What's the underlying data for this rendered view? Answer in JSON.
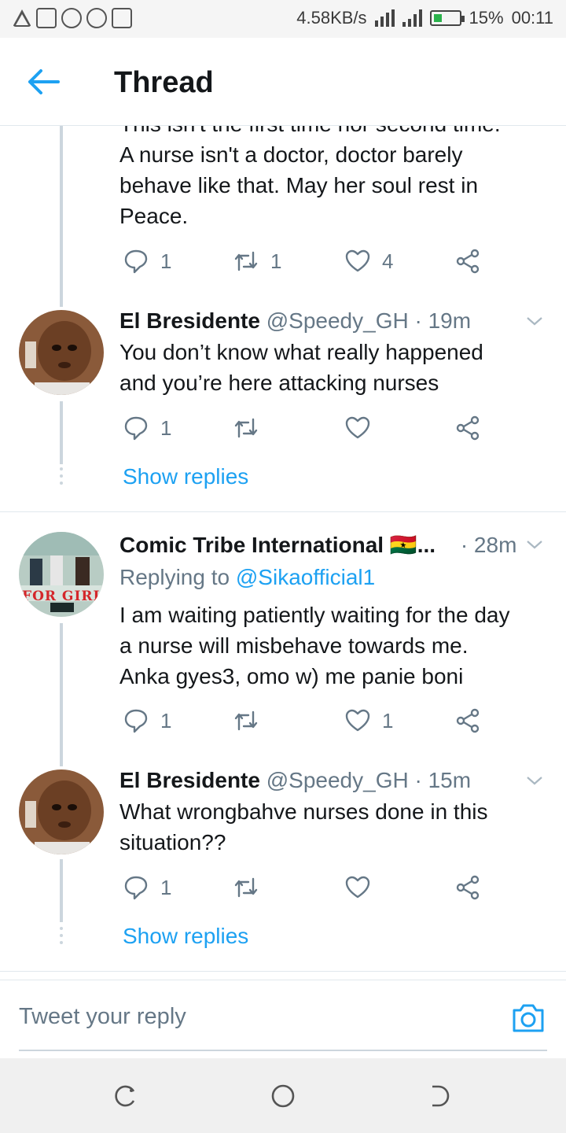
{
  "status_bar": {
    "net_speed": "4.58KB/s",
    "battery": "15%",
    "time": "00:11"
  },
  "header": {
    "title": "Thread"
  },
  "tweets": [
    {
      "text": "This isn't the first time nor second time.\nA nurse isn't a doctor, doctor barely\nbehave like that. May her soul rest in\nPeace.",
      "replies": "1",
      "retweets": "1",
      "likes": "4"
    },
    {
      "name": "El Bresidente",
      "handle": "@Speedy_GH · 19m",
      "text": "You don’t know what really happened\nand you’re here attacking nurses",
      "replies": "1",
      "retweets": "",
      "likes": "",
      "show_replies": "Show replies"
    },
    {
      "name": "Comic Tribe International 🇬🇭...",
      "handle": "· 28m",
      "replying_prefix": "Replying to",
      "replying_to": "@Sikaofficial1",
      "text": "I am waiting patiently waiting for the day\na nurse will misbehave towards me.\nAnka gyes3, omo w) me panie boni",
      "replies": "1",
      "retweets": "",
      "likes": "1",
      "avatar_text": "FOR GIRLS"
    },
    {
      "name": "El Bresidente",
      "handle": "@Speedy_GH · 15m",
      "text": "What wrongbahve nurses done in this\nsituation??",
      "replies": "1",
      "retweets": "",
      "likes": "",
      "show_replies": "Show replies"
    }
  ],
  "reply_bar": {
    "placeholder": "Tweet your reply"
  },
  "colors": {
    "accent": "#1da1f2",
    "text": "#14171a",
    "muted": "#657786",
    "divider": "#e1e8ed"
  }
}
